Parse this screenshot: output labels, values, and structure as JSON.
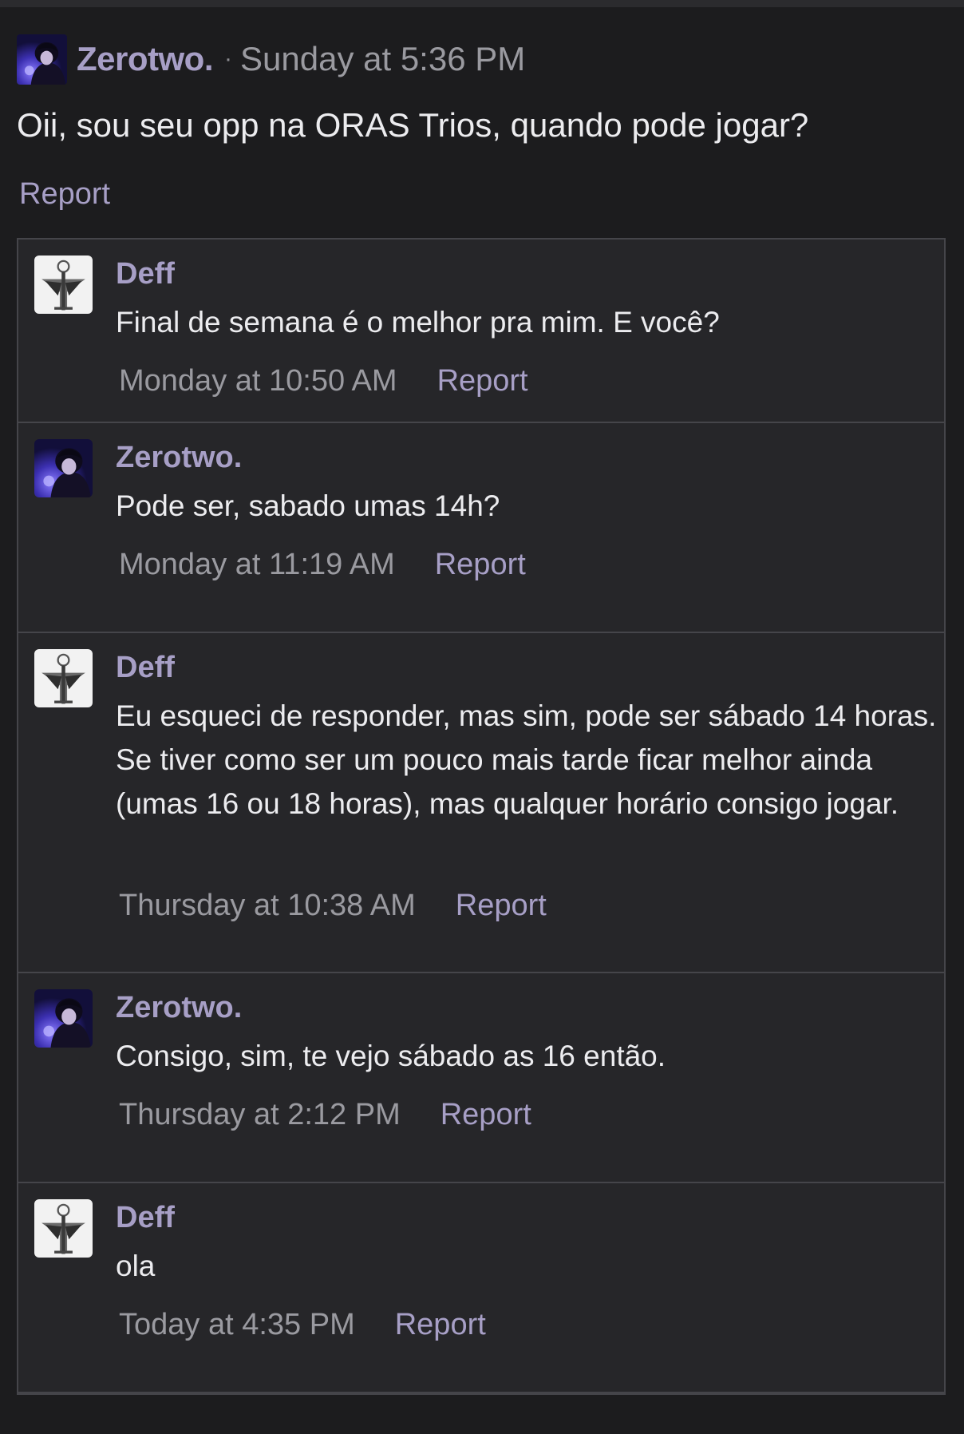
{
  "post": {
    "author": "Zerotwo.",
    "separator": "·",
    "time": "Sunday at 5:36 PM",
    "body": "Oii, sou seu opp na ORAS Trios, quando pode jogar?",
    "report_label": "Report"
  },
  "replies": [
    {
      "author": "Deff",
      "avatar": "deff-avatar",
      "text": "Final de semana é o melhor pra mim. E você?",
      "time": "Monday at 10:50 AM",
      "report_label": "Report"
    },
    {
      "author": "Zerotwo.",
      "avatar": "zerotwo-avatar",
      "text": "Pode ser, sabado umas 14h?",
      "time": "Monday at 11:19 AM",
      "report_label": "Report"
    },
    {
      "author": "Deff",
      "avatar": "deff-avatar",
      "text": "Eu esqueci de responder, mas sim, pode ser sábado 14 horas. Se tiver como ser um pouco mais tarde ficar melhor ainda (umas 16 ou 18 horas), mas qualquer horário consigo jogar.",
      "time": "Thursday at 10:38 AM",
      "report_label": "Report"
    },
    {
      "author": "Zerotwo.",
      "avatar": "zerotwo-avatar",
      "text": "Consigo, sim, te vejo sábado as 16 então.",
      "time": "Thursday at 2:12 PM",
      "report_label": "Report"
    },
    {
      "author": "Deff",
      "avatar": "deff-avatar",
      "text": "ola",
      "time": "Today at 4:35 PM",
      "report_label": "Report"
    }
  ]
}
